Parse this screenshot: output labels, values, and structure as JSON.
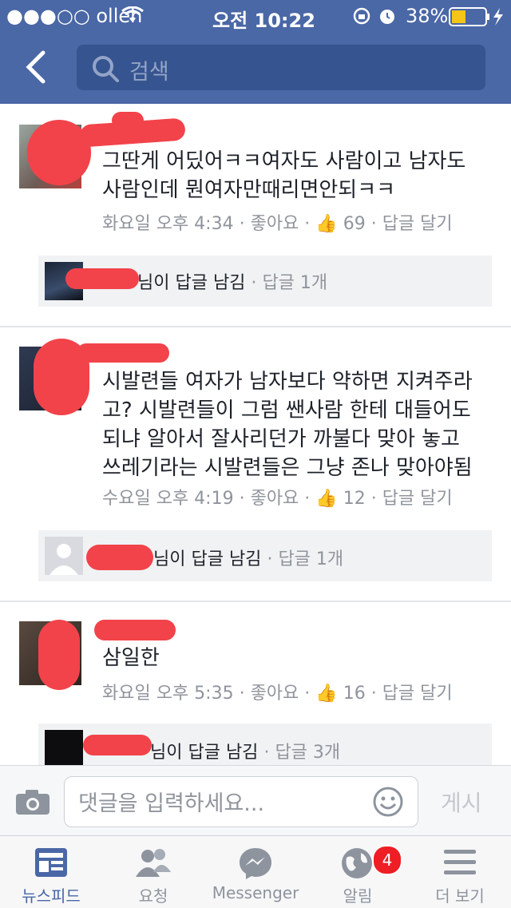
{
  "status": {
    "carrier": "●●●○○ olleh",
    "time": "오전 10:22",
    "battery": "38%"
  },
  "search": {
    "placeholder": "검색"
  },
  "comments": [
    {
      "text": "그딴게 어딨어ㅋㅋ여자도 사람이고 남자도 사람인데 뭔여자만때리면안되ㅋㅋ",
      "time": "화요일 오후 4:34",
      "like_label": "좋아요",
      "likes": "69",
      "reply_label": "답글 달기",
      "reply_summary": "님이 답글 남김",
      "reply_count": "답글 1개"
    },
    {
      "text": "시발련들 여자가 남자보다 약하면 지켜주라고? 시발련들이 그럼 쌘사람 한테 대들어도되냐 알아서 잘사리던가 까불다 맞아 놓고 쓰레기라는 시발련들은 그냥 존나 맞아야됨",
      "time": "수요일 오후 4:19",
      "like_label": "좋아요",
      "likes": "12",
      "reply_label": "답글 달기",
      "reply_summary": "님이 답글 남김",
      "reply_count": "답글 1개"
    },
    {
      "text": "삼일한",
      "time": "화요일 오후 5:35",
      "like_label": "좋아요",
      "likes": "16",
      "reply_label": "답글 달기",
      "reply_summary": "님이 답글 남김",
      "reply_count": "답글 3개"
    }
  ],
  "composer": {
    "placeholder": "댓글을 입력하세요...",
    "post_label": "게시"
  },
  "tabs": [
    {
      "label": "뉴스피드",
      "icon": "newsfeed-icon"
    },
    {
      "label": "요청",
      "icon": "friend-requests-icon"
    },
    {
      "label": "Messenger",
      "icon": "messenger-icon"
    },
    {
      "label": "알림",
      "icon": "notifications-globe-icon",
      "badge": "4"
    },
    {
      "label": "더 보기",
      "icon": "menu-icon"
    }
  ],
  "colors": {
    "brand": "#4a67a6",
    "badge": "#ef1d24",
    "redaction": "#f2434a"
  }
}
